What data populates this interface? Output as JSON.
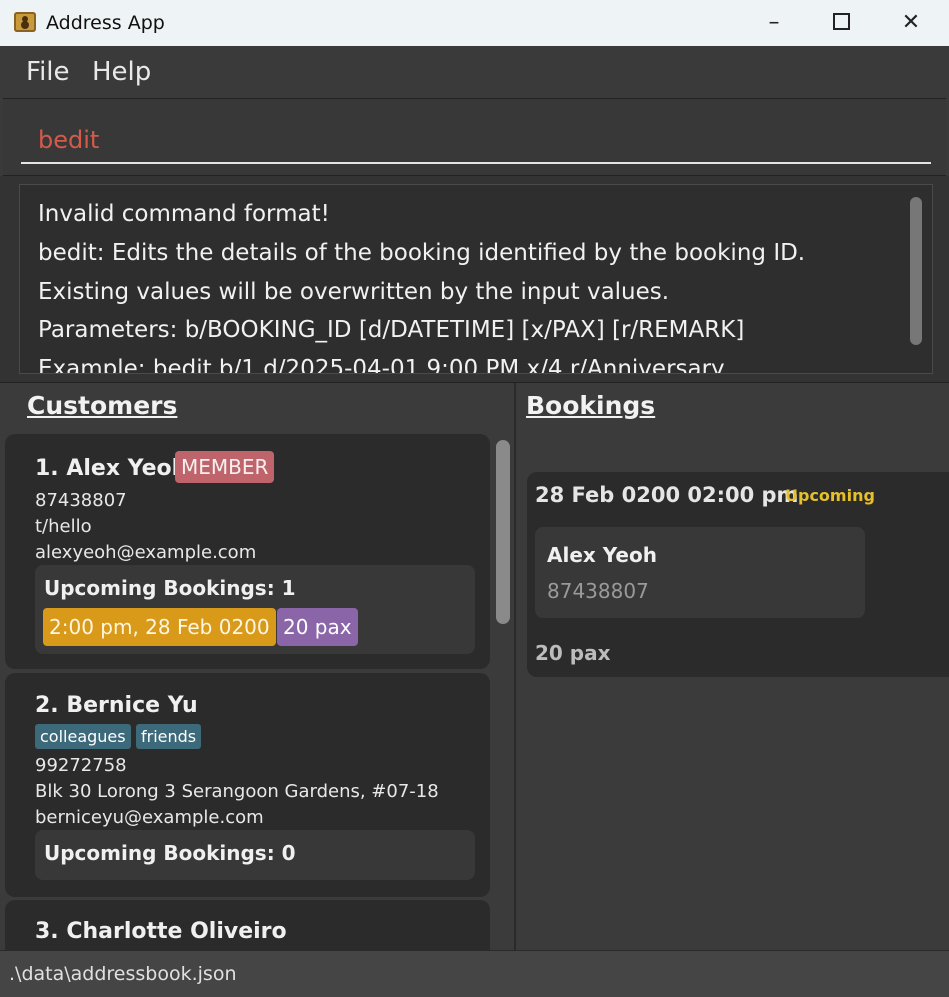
{
  "window": {
    "title": "Address App",
    "app_icon": "address-book-icon",
    "controls": {
      "minimize": "–",
      "close": "✕"
    }
  },
  "menu": {
    "file": "File",
    "help": "Help"
  },
  "command": {
    "value": "bedit",
    "placeholder": ""
  },
  "result": {
    "lines": [
      "Invalid command format!",
      "bedit: Edits the details of the booking identified by the booking ID.",
      "Existing values will be overwritten by the input values.",
      "Parameters: b/BOOKING_ID [d/DATETIME] [x/PAX] [r/REMARK]",
      "Example: bedit b/1 d/2025-04-01 9:00 PM x/4 r/Anniversary"
    ]
  },
  "customers": {
    "heading": "Customers",
    "items": [
      {
        "name": "1. Alex Yeoh",
        "badge": "MEMBER",
        "phone": "87438807",
        "tag_line": "t/hello",
        "email": "alexyeoh@example.com",
        "upcoming_label": "Upcoming Bookings:  1",
        "booking_time": "2:00 pm, 28 Feb 0200",
        "booking_pax": "20 pax"
      },
      {
        "name": "2. Bernice Yu",
        "tags": [
          "colleagues",
          "friends"
        ],
        "phone": "99272758",
        "address": "Blk 30 Lorong 3 Serangoon Gardens, #07-18",
        "email": "berniceyu@example.com",
        "upcoming_label": "Upcoming Bookings:  0"
      },
      {
        "name": "3. Charlotte Oliveiro"
      }
    ]
  },
  "bookings": {
    "heading": "Bookings",
    "items": [
      {
        "datetime": "28 Feb 0200 02:00 pm",
        "status": "Upcoming",
        "customer_name": "Alex Yeoh",
        "customer_phone": "87438807",
        "pax": "20 pax"
      }
    ]
  },
  "status": {
    "path": ".\\data\\addressbook.json"
  },
  "colors": {
    "member_badge": "#c0646c",
    "tag": "#3d6a7a",
    "booking_time_chip": "#d99a1a",
    "pax_chip": "#8a66a8",
    "upcoming_status": "#e6c02a",
    "command_text": "#d45a4a"
  }
}
